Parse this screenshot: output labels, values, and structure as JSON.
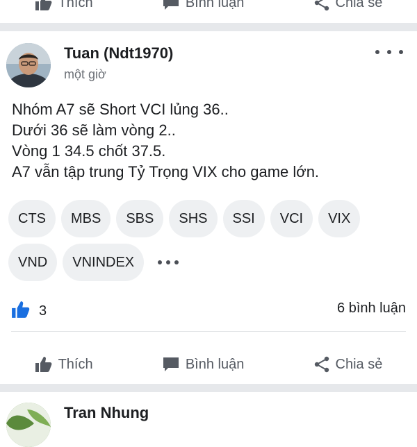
{
  "actions": {
    "like_label": "Thích",
    "comment_label": "Bình luận",
    "share_label": "Chia sẻ"
  },
  "post": {
    "author": "Tuan (Ndt1970)",
    "time": "một giờ",
    "lines": [
      "Nhóm A7 sẽ Short VCI lủng 36..",
      "Dưới 36 sẽ làm vòng 2..",
      "Vòng 1 34.5 chốt 37.5.",
      "A7 vẫn tập trung Tỷ Trọng VIX cho game lớn."
    ],
    "tags_row1": [
      "CTS",
      "MBS",
      "SBS",
      "SHS",
      "SSI",
      "VCI",
      "VIX"
    ],
    "tags_row2": [
      "VND",
      "VNINDEX"
    ],
    "like_count": "3",
    "comment_count": "6 bình luận"
  },
  "next_post": {
    "author": "Tran Nhung"
  },
  "colors": {
    "like_blue": "#1a6fe0",
    "icon_gray": "#555a62",
    "separator": "#e6e8eb"
  }
}
